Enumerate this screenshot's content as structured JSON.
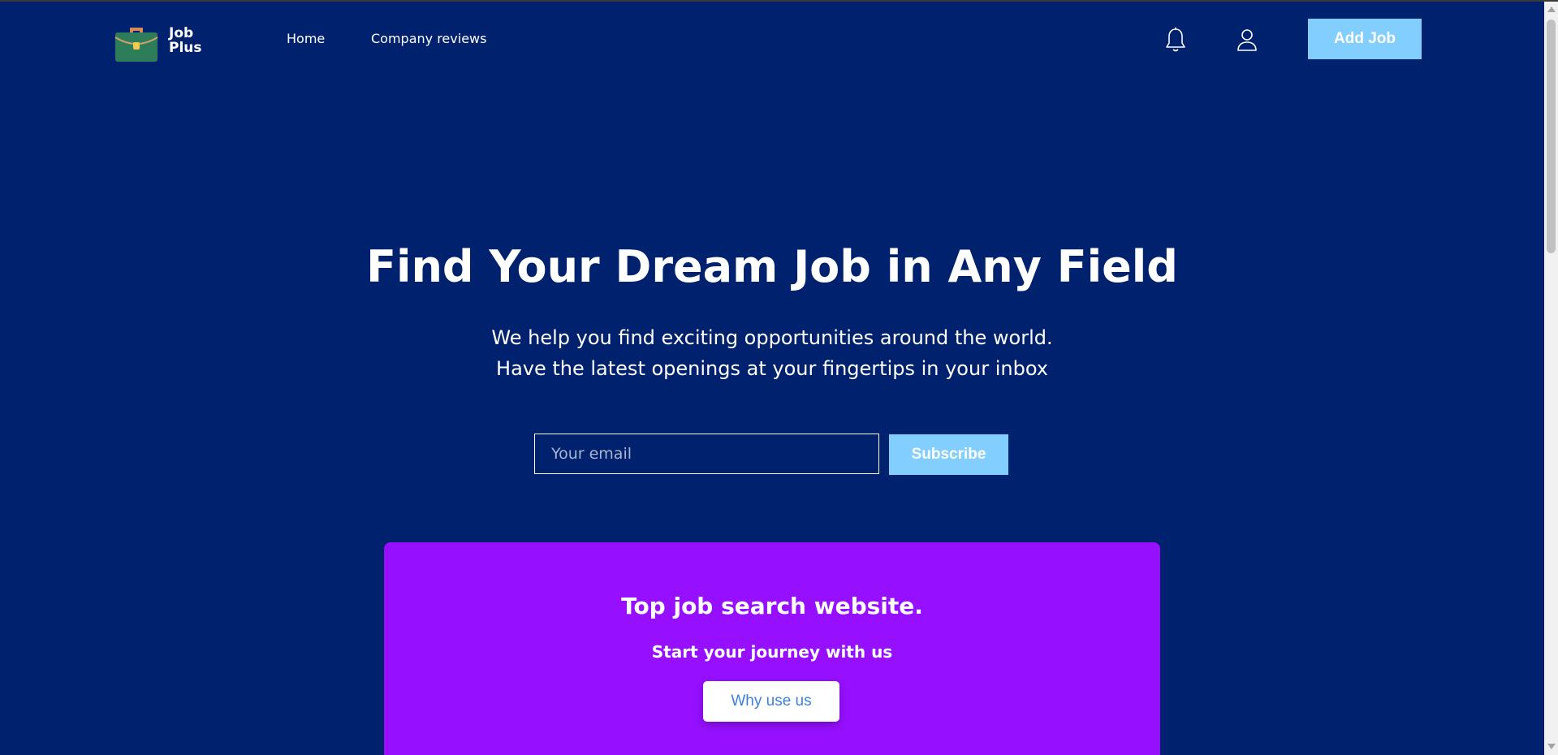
{
  "header": {
    "logo_line1": "Job",
    "logo_line2": "Plus",
    "nav": {
      "home": "Home",
      "reviews": "Company reviews"
    },
    "icons": {
      "notifications": "bell-icon",
      "account": "user-icon"
    },
    "add_job_label": "Add Job"
  },
  "hero": {
    "title": "Find Your Dream Job in Any Field",
    "subtitle_line1": "We help you find exciting opportunities around the world.",
    "subtitle_line2": "Have the latest openings at your fingertips in your inbox",
    "email_placeholder": "Your email",
    "subscribe_label": "Subscribe"
  },
  "promo": {
    "title": "Top job search website.",
    "subtitle": "Start your journey with us",
    "button_label": "Why use us"
  },
  "colors": {
    "background": "#00226e",
    "accent": "#82cfff",
    "card": "#9610ff",
    "card_button_text": "#3d7fe0"
  }
}
